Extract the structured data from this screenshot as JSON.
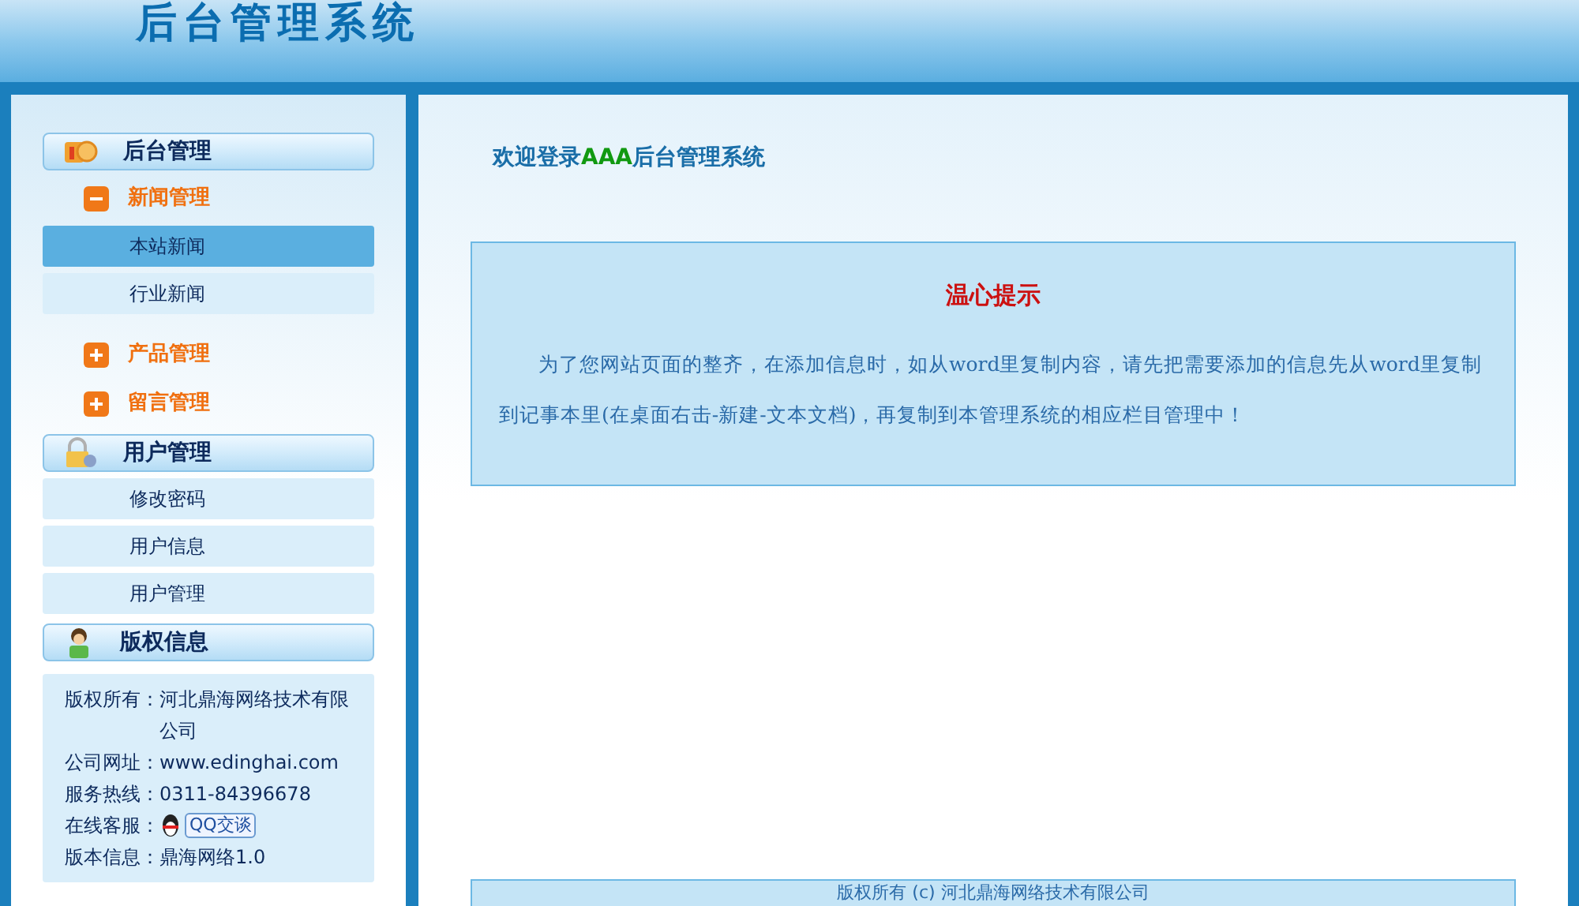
{
  "header": {
    "title": "后台管理系统"
  },
  "sidebar": {
    "sections": [
      {
        "title": "后台管理",
        "groups": [
          {
            "label": "新闻管理",
            "expanded": true,
            "items": [
              {
                "label": "本站新闻",
                "selected": true
              },
              {
                "label": "行业新闻",
                "selected": false
              }
            ]
          },
          {
            "label": "产品管理",
            "expanded": false
          },
          {
            "label": "留言管理",
            "expanded": false
          }
        ]
      },
      {
        "title": "用户管理",
        "items": [
          {
            "label": "修改密码",
            "selected": false
          },
          {
            "label": "用户信息",
            "selected": false
          },
          {
            "label": "用户管理",
            "selected": false
          }
        ]
      },
      {
        "title": "版权信息",
        "info": [
          {
            "kind": "text",
            "label": "版权所有：",
            "value": "河北鼎海网络技术有限公司"
          },
          {
            "kind": "text",
            "label": "公司网址：",
            "value": "www.edinghai.com"
          },
          {
            "kind": "text",
            "label": "服务热线：",
            "value": "0311-84396678"
          },
          {
            "kind": "qq",
            "label": "在线客服：",
            "value": "QQ交谈"
          },
          {
            "kind": "text",
            "label": "版本信息：",
            "value": "鼎海网络1.0"
          }
        ]
      }
    ]
  },
  "main": {
    "welcome": {
      "before": "欢迎登录",
      "highlight": "AAA",
      "after": "后台管理系统"
    },
    "notice": {
      "title": "温心提示",
      "body": "为了您网站页面的整齐，在添加信息时，如从word里复制内容，请先把需要添加的信息先从word里复制到记事本里(在桌面右击-新建-文本文档)，再复制到本管理系统的相应栏目管理中！"
    },
    "footer": "版权所有 (c) 河北鼎海网络技术有限公司"
  }
}
